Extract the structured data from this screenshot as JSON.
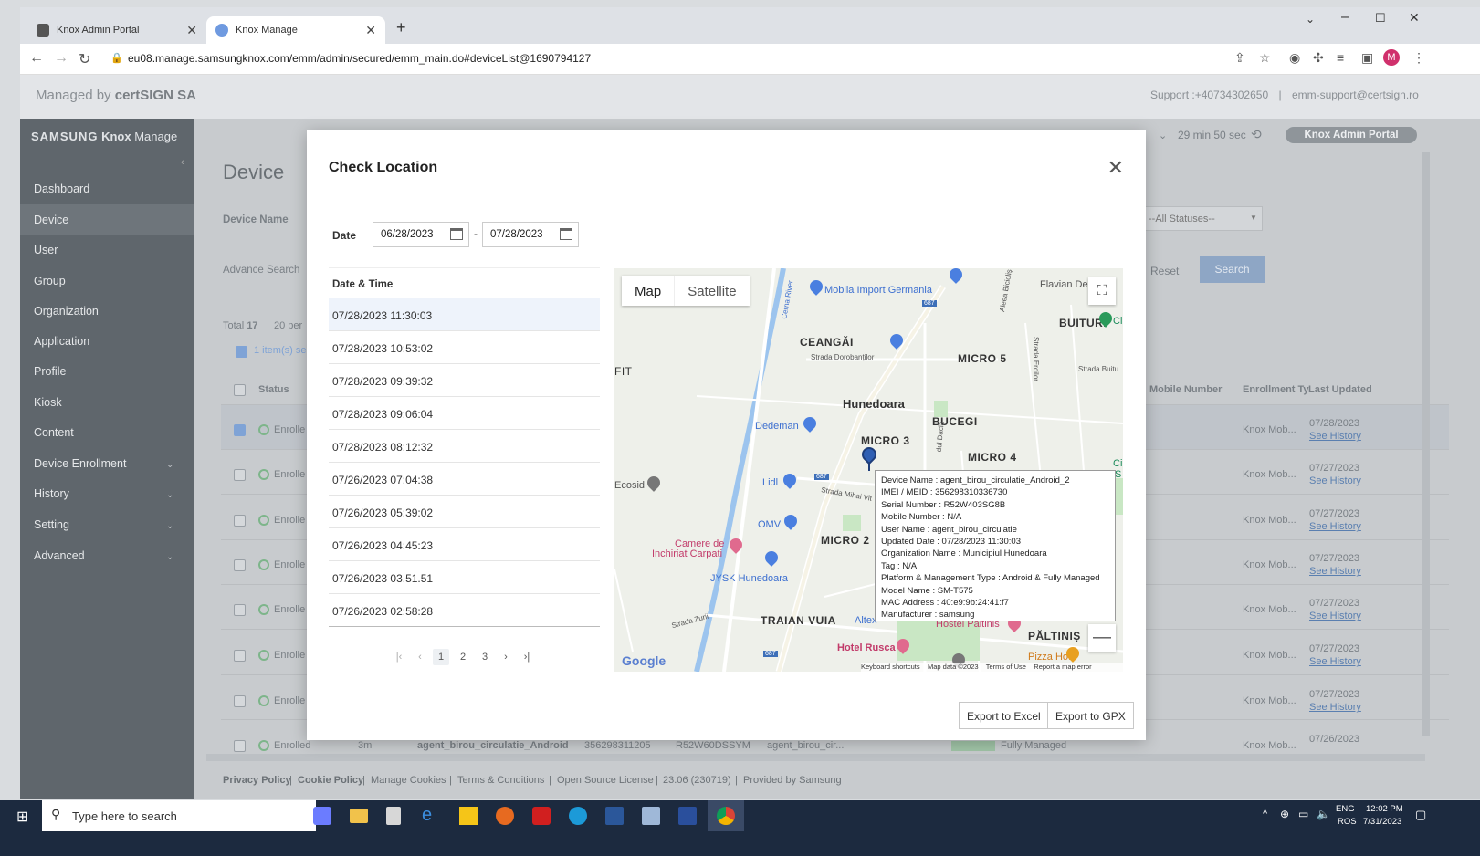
{
  "browser": {
    "tabs": [
      {
        "label": "Knox Admin Portal"
      },
      {
        "label": "Knox Manage"
      }
    ],
    "url": "eu08.manage.samsungknox.com/emm/admin/secured/emm_main.do#deviceList@1690794127",
    "profile_initial": "M"
  },
  "header": {
    "managed_by_prefix": "Managed by ",
    "managed_by_org": "certSIGN SA",
    "support": "Support :+40734302650",
    "support_email": "emm-support@certsign.ro",
    "session_timer": "29 min 50 sec",
    "admin_portal_button": "Knox Admin Portal"
  },
  "sidebar": {
    "brand_samsung": "SAMSUNG",
    "brand_knox": "Knox",
    "brand_manage": "Manage",
    "items": [
      {
        "label": "Dashboard"
      },
      {
        "label": "Device"
      },
      {
        "label": "User"
      },
      {
        "label": "Group"
      },
      {
        "label": "Organization"
      },
      {
        "label": "Application"
      },
      {
        "label": "Profile"
      },
      {
        "label": "Kiosk"
      },
      {
        "label": "Content"
      },
      {
        "label": "Device Enrollment"
      },
      {
        "label": "History"
      },
      {
        "label": "Setting"
      },
      {
        "label": "Advanced"
      }
    ]
  },
  "main": {
    "page_title": "Device",
    "device_name_label": "Device Name",
    "advance_search": "Advance Search",
    "status_filter": "--All Statuses--",
    "reset": "Reset",
    "search": "Search",
    "total_label": "Total",
    "total_count": "17",
    "per_page": "20 per",
    "selected": "1 item(s) se",
    "columns": {
      "status": "Status",
      "mobile_number": "Mobile Number",
      "enrollment_type": "Enrollment Ty",
      "last_updated": "Last Updated"
    },
    "rows": [
      {
        "status": "Enrolle",
        "enrollment": "Knox Mob...",
        "date": "07/28/2023",
        "history": "See History"
      },
      {
        "status": "Enrolle",
        "enrollment": "Knox Mob...",
        "date": "07/27/2023",
        "history": "See History"
      },
      {
        "status": "Enrolle",
        "enrollment": "Knox Mob...",
        "date": "07/27/2023",
        "history": "See History"
      },
      {
        "status": "Enrolle",
        "enrollment": "Knox Mob...",
        "date": "07/27/2023",
        "history": "See History"
      },
      {
        "status": "Enrolle",
        "enrollment": "Knox Mob...",
        "date": "07/27/2023",
        "history": "See History"
      },
      {
        "status": "Enrolle",
        "enrollment": "Knox Mob...",
        "date": "07/27/2023",
        "history": "See History"
      },
      {
        "status": "Enrolle",
        "enrollment": "Knox Mob...",
        "date": "07/27/2023",
        "history": "See History"
      }
    ],
    "last_row": {
      "status": "Enrolled",
      "age": "3m",
      "name": "agent_birou_circulatie_Android",
      "imei": "356298311205",
      "serial": "R52W60DSSYM",
      "user": "agent_birou_cir...",
      "type": "Fully Managed",
      "enrollment": "Knox Mob...",
      "date": "07/26/2023"
    }
  },
  "footer": {
    "privacy": "Privacy Policy",
    "cookie": "Cookie Policy",
    "manage_cookies": "Manage Cookies",
    "terms": "Terms & Conditions",
    "open_source": "Open Source License",
    "version": "23.06 (230719)",
    "provided": "Provided by Samsung"
  },
  "modal": {
    "title": "Check Location",
    "date_label": "Date",
    "date_from": "06/28/2023",
    "date_sep": "-",
    "date_to": "07/28/2023",
    "list_header": "Date & Time",
    "entries": [
      "07/28/2023 11:30:03",
      "07/28/2023 10:53:02",
      "07/28/2023 09:39:32",
      "07/28/2023 09:06:04",
      "07/28/2023 08:12:32",
      "07/26/2023 07:04:38",
      "07/26/2023 05:39:02",
      "07/26/2023 04:45:23",
      "07/26/2023 03.51.51",
      "07/26/2023 02:58:28"
    ],
    "pages": [
      "1",
      "2",
      "3"
    ],
    "export_excel": "Export to Excel",
    "export_gpx": "Export to GPX"
  },
  "map": {
    "map_button": "Map",
    "satellite_button": "Satellite",
    "labels": {
      "hunedoara": "Hunedoara",
      "ceangai": "CEANGĂI",
      "micro5": "MICRO 5",
      "bucegi": "BUCEGI",
      "micro3": "MICRO 3",
      "micro4": "MICRO 4",
      "micro2": "MICRO 2",
      "traian_vuia": "TRAIAN VUIA",
      "paltinis": "PĂLTINIȘ",
      "buituri": "BUITURI",
      "fit": "FIT",
      "flavian": "Flavian De",
      "mobila": "Mobila Import Germania",
      "dedeman": "Dedeman",
      "lidl": "Lidl",
      "omv": "OMV",
      "ecosid": "Ecosid",
      "camere": "Camere de",
      "inchiriat": "Inchiriat Carpati",
      "jysk": "JYSK Hunedoara",
      "hotel_rusca": "Hotel Rusca",
      "hostel": "Hostel Paltinis",
      "pizza": "Pizza Hot",
      "altex": "Altex",
      "cin": "Cin",
      "ci": "Ci",
      "s": "S",
      "strada_dorobantilor": "Strada Dorobanților",
      "strada_zurii": "Strada Zurii",
      "strada_mihai": "Strada Mihai Vit",
      "strada_buitu": "Strada Buitu",
      "strada_eroilor": "Strada Eroilor",
      "aleea": "Aleea Bicicliş",
      "cerna": "Cerna River",
      "dacia": "dul Dacia",
      "road687": "687",
      "google": "Google"
    },
    "attribution": {
      "keyboard": "Keyboard shortcuts",
      "data": "Map data ©2023",
      "terms": "Terms of Use",
      "report": "Report a map error"
    },
    "tooltip": [
      "Device Name : agent_birou_circulatie_Android_2",
      "IMEI / MEID : 356298310336730",
      "Serial Number : R52W403SG8B",
      "Mobile Number : N/A",
      "User Name : agent_birou_circulatie",
      "Updated Date : 07/28/2023 11:30:03",
      "Organization Name : Municipiul Hunedoara",
      "Tag : N/A",
      "Platform & Management Type : Android & Fully Managed",
      "Model Name : SM-T575",
      "MAC Address : 40:e9:9b:24:41:f7",
      "Manufacturer : samsung"
    ]
  },
  "taskbar": {
    "search_placeholder": "Type here to search",
    "lang_top": "ENG",
    "lang_bottom": "ROS",
    "time": "12:02 PM",
    "date": "7/31/2023"
  },
  "colors": {
    "accent_blue": "#7ea6e0",
    "sidebar_bg": "#5f666c",
    "taskbar_bg": "#1c2a3f",
    "status_green": "#7db58a"
  }
}
